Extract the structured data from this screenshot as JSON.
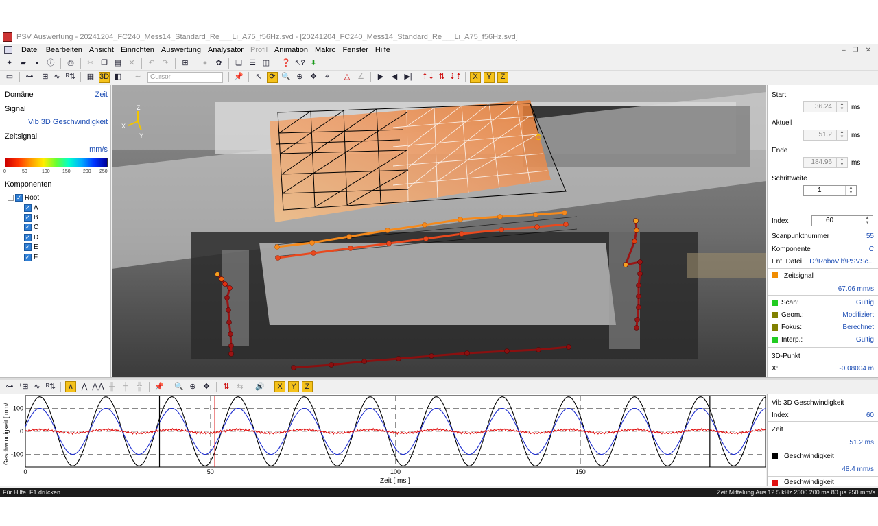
{
  "window": {
    "title": "PSV Auswertung - 20241204_FC240_Mess14_Standard_Re___Li_A75_f56Hz.svd - [20241204_FC240_Mess14_Standard_Re___Li_A75_f56Hz.svd]"
  },
  "menu": [
    "Datei",
    "Bearbeiten",
    "Ansicht",
    "Einrichten",
    "Auswertung",
    "Analysator",
    "Profil",
    "Animation",
    "Makro",
    "Fenster",
    "Hilfe"
  ],
  "toolbar": {
    "cursor_placeholder": "Cursor",
    "view3d_label": "3D",
    "axis_x": "X",
    "axis_y": "Y",
    "axis_z": "Z"
  },
  "left_panel": {
    "domain_label": "Domäne",
    "domain_value": "Zeit",
    "signal_label": "Signal",
    "signal_value": "Vib 3D Geschwindigkeit",
    "timesignal_label": "Zeitsignal",
    "unit": "mm/s",
    "colorbar_ticks": [
      "0",
      "50",
      "100",
      "150",
      "200",
      "250"
    ],
    "components_label": "Komponenten",
    "tree": {
      "root": "Root",
      "items": [
        "A",
        "B",
        "C",
        "D",
        "E",
        "F"
      ]
    }
  },
  "view3d": {
    "axis_labels": {
      "x": "X",
      "y": "Y",
      "z": "Z"
    }
  },
  "right_panel": {
    "start_label": "Start",
    "start_value": "36.24",
    "start_unit": "ms",
    "current_label": "Aktuell",
    "current_value": "51.2",
    "current_unit": "ms",
    "end_label": "Ende",
    "end_value": "184.96",
    "end_unit": "ms",
    "step_label": "Schrittweite",
    "step_value": "1",
    "index_label": "Index",
    "index_value": "60",
    "scanpoint_label": "Scanpunktnummer",
    "scanpoint_value": "55",
    "component_label": "Komponente",
    "component_value": "C",
    "file_label": "Ent. Datei",
    "file_value": "D:\\RoboVib\\PSVSc...",
    "zeitsignal_label": "Zeitsignal",
    "zeitsignal_value": "67.06 mm/s",
    "scan_label": "Scan:",
    "scan_value": "Gültig",
    "geom_label": "Geom.:",
    "geom_value": "Modifiziert",
    "fokus_label": "Fokus:",
    "fokus_value": "Berechnet",
    "interp_label": "Interp.:",
    "interp_value": "Gültig",
    "point3d_label": "3D-Punkt",
    "x_label": "X:",
    "x_value": "-0.08004 m",
    "colors": {
      "zeitsignal": "#f08c00",
      "scan": "#22cc22",
      "geom": "#808000",
      "fokus": "#808000",
      "interp": "#22cc22"
    }
  },
  "bottom_panel": {
    "signal_value": "Vib 3D Geschwindigkeit",
    "index_label": "Index",
    "index_value": "60",
    "time_label": "Zeit",
    "time_value": "51.2 ms",
    "series1_label": "Geschwindigkeit",
    "series1_value": "48.4 mm/s",
    "series2_label": "Geschwindigkeit"
  },
  "chart_data": {
    "type": "line",
    "xlabel": "Zeit [ ms ]",
    "ylabel": "Geschwindigkeit [ mm/...",
    "xlim": [
      0,
      200
    ],
    "ylim": [
      -155,
      155
    ],
    "x_ticks": [
      0,
      50,
      100,
      150
    ],
    "y_ticks": [
      100,
      0,
      -100
    ],
    "frequency_hz": 56,
    "cursor_x": 51.2,
    "vertical_markers": [
      36.24,
      184.96
    ],
    "series": [
      {
        "color": "#000000",
        "amplitude": 150
      },
      {
        "color": "#1f2fd0",
        "amplitude": 100
      },
      {
        "color": "#e01010",
        "amplitude": 8
      }
    ]
  },
  "statusbar": {
    "help": "Für Hilfe, F1 drücken",
    "info": "Zeit  Mittelung Aus   12.5 kHz  2500   200 ms   80 µs   250 mm/s"
  }
}
